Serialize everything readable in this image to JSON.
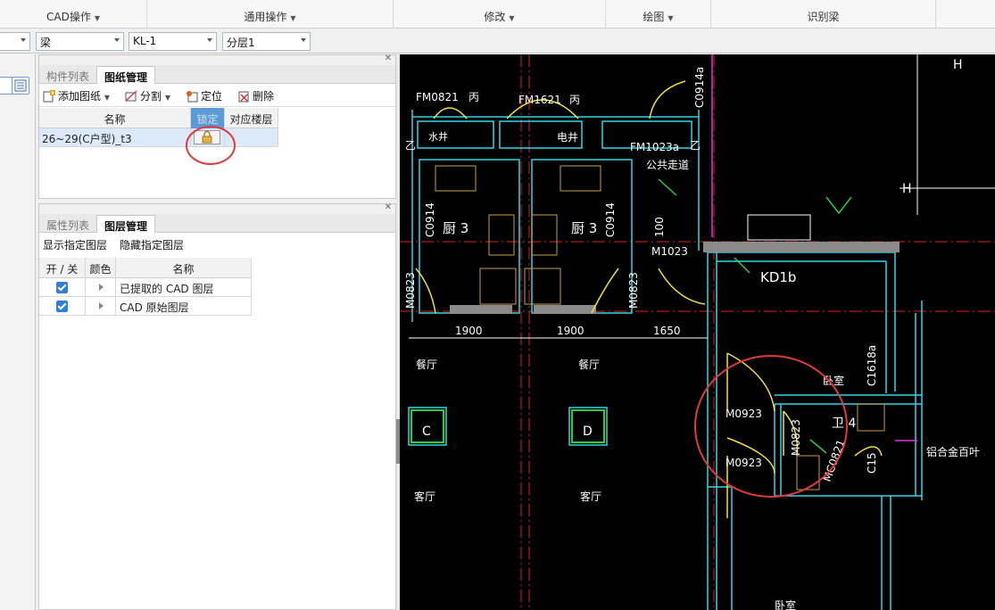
{
  "ribbon": {
    "groups": [
      "CAD操作",
      "通用操作",
      "修改",
      "绘图",
      "识别梁"
    ]
  },
  "selectors": {
    "floor": "",
    "type": "梁",
    "member": "KL-1",
    "layer": "分层1"
  },
  "drawing_panel": {
    "tabs": [
      "构件列表",
      "图纸管理"
    ],
    "active_tab": "图纸管理",
    "toolbar": {
      "add": "添加图纸",
      "split": "分割",
      "locate": "定位",
      "delete": "删除"
    },
    "columns": [
      "名称",
      "锁定",
      "对应楼层"
    ],
    "rows": [
      {
        "name": "26~29(C户型)_t3",
        "locked": true,
        "floor": ""
      }
    ]
  },
  "layer_panel": {
    "tabs": [
      "属性列表",
      "图层管理"
    ],
    "active_tab": "图层管理",
    "actions": {
      "show": "显示指定图层",
      "hide": "隐藏指定图层"
    },
    "columns": [
      "开 / 关",
      "颜色",
      "名称"
    ],
    "rows": [
      {
        "on": true,
        "name": "已提取的 CAD 图层"
      },
      {
        "on": true,
        "name": "CAD 原始图层"
      }
    ]
  },
  "cad": {
    "labels": {
      "fm0821": "FM0821",
      "bing1": "丙",
      "fm1621": "FM1621",
      "bing2": "丙",
      "c0914a": "C0914a",
      "fm1023a": "FM1023a",
      "gonggong": "公共走道",
      "dianjing": "电井",
      "shuijing": "水井",
      "yi1": "乙",
      "yi2": "乙",
      "c0914_1": "C0914",
      "chu1": "厨 3",
      "chu2": "厨 3",
      "c0914_2": "C0914",
      "n100": "100",
      "m1023": "M1023",
      "kd1b": "KD1b",
      "m0823_1": "M0823",
      "m0823_2": "M0823",
      "d1900a": "1900",
      "d1900b": "1900",
      "d1650": "1650",
      "canting1": "餐厅",
      "canting2": "餐厅",
      "woshi": "卧室",
      "c1618a": "C1618a",
      "m0923a": "M0923",
      "m0923b": "M0923",
      "wei4": "卫 4",
      "m0823_3": "M0823",
      "mc0821": "MC0821",
      "c15": "C15",
      "baiye": "铝合金百叶",
      "col_c": "C",
      "col_d": "D",
      "keting1": "客厅",
      "keting2": "客厅",
      "h1": "H",
      "h2": "H",
      "woshi2": "卧室"
    },
    "highlight_color": "#e03b3b"
  }
}
